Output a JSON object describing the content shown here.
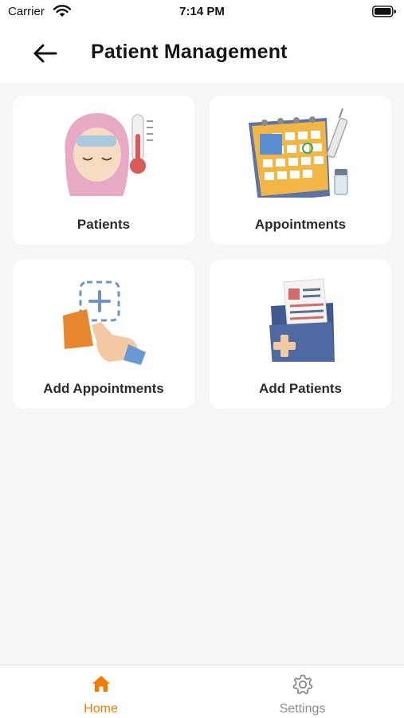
{
  "status_bar": {
    "carrier": "Carrier",
    "time": "7:14 PM",
    "wifi_icon": "wifi-icon",
    "battery_icon": "battery-icon"
  },
  "header": {
    "back_icon": "arrow-left-icon",
    "title": "Patient Management"
  },
  "cards": [
    {
      "label": "Patients",
      "icon": "sick-patient-thermometer-icon"
    },
    {
      "label": "Appointments",
      "icon": "calendar-syringe-icon"
    },
    {
      "label": "Add Appointments",
      "icon": "add-appointment-hand-icon"
    },
    {
      "label": "Add Patients",
      "icon": "medical-folder-icon"
    }
  ],
  "bottom_nav": {
    "items": [
      {
        "label": "Home",
        "icon": "home-icon",
        "active": true
      },
      {
        "label": "Settings",
        "icon": "gear-icon",
        "active": false
      }
    ]
  },
  "colors": {
    "accent": "#f07d00",
    "inactive": "#8d8d8d",
    "background": "#f6f6f6",
    "card": "#ffffff"
  }
}
